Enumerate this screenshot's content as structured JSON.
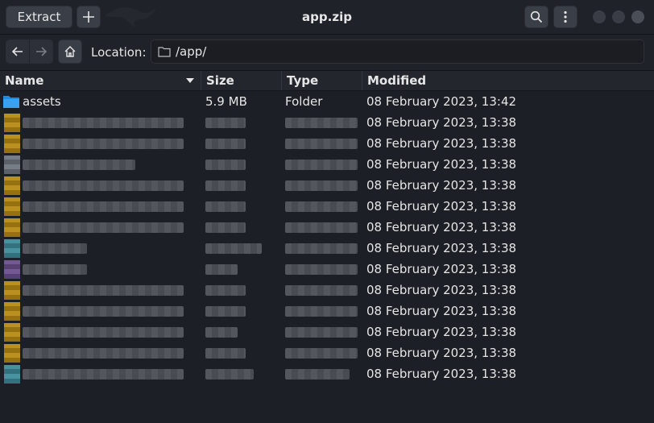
{
  "header": {
    "title": "app.zip",
    "extract_label": "Extract",
    "add_label": "+",
    "search_icon": "search-icon",
    "menu_icon": "kebab-menu-icon"
  },
  "location": {
    "label": "Location:",
    "path": "/app/"
  },
  "columns": {
    "name": "Name",
    "size": "Size",
    "type": "Type",
    "modified": "Modified"
  },
  "colors": {
    "folder": "#1e8be3",
    "file_yellow": "#b68a12",
    "file_teal": "#3d8a99",
    "file_purple": "#6a4f8c",
    "file_grey": "#6f7580"
  },
  "rows": [
    {
      "name": "assets",
      "size": "5.9 MB",
      "type": "Folder",
      "modified": "08 February 2023, 13:42",
      "kind": "folder"
    },
    {
      "modified": "08 February 2023, 13:38",
      "kind": "file",
      "icon_color": "yellow"
    },
    {
      "modified": "08 February 2023, 13:38",
      "kind": "file",
      "icon_color": "yellow"
    },
    {
      "modified": "08 February 2023, 13:38",
      "kind": "file",
      "icon_color": "grey"
    },
    {
      "modified": "08 February 2023, 13:38",
      "kind": "file",
      "icon_color": "yellow"
    },
    {
      "modified": "08 February 2023, 13:38",
      "kind": "file",
      "icon_color": "yellow"
    },
    {
      "modified": "08 February 2023, 13:38",
      "kind": "file",
      "icon_color": "yellow"
    },
    {
      "modified": "08 February 2023, 13:38",
      "kind": "file",
      "icon_color": "teal"
    },
    {
      "modified": "08 February 2023, 13:38",
      "kind": "file",
      "icon_color": "purple"
    },
    {
      "modified": "08 February 2023, 13:38",
      "kind": "file",
      "icon_color": "yellow"
    },
    {
      "modified": "08 February 2023, 13:38",
      "kind": "file",
      "icon_color": "yellow"
    },
    {
      "modified": "08 February 2023, 13:38",
      "kind": "file",
      "icon_color": "yellow"
    },
    {
      "modified": "08 February 2023, 13:38",
      "kind": "file",
      "icon_color": "yellow"
    },
    {
      "modified": "08 February 2023, 13:38",
      "kind": "file",
      "icon_color": "teal"
    }
  ]
}
